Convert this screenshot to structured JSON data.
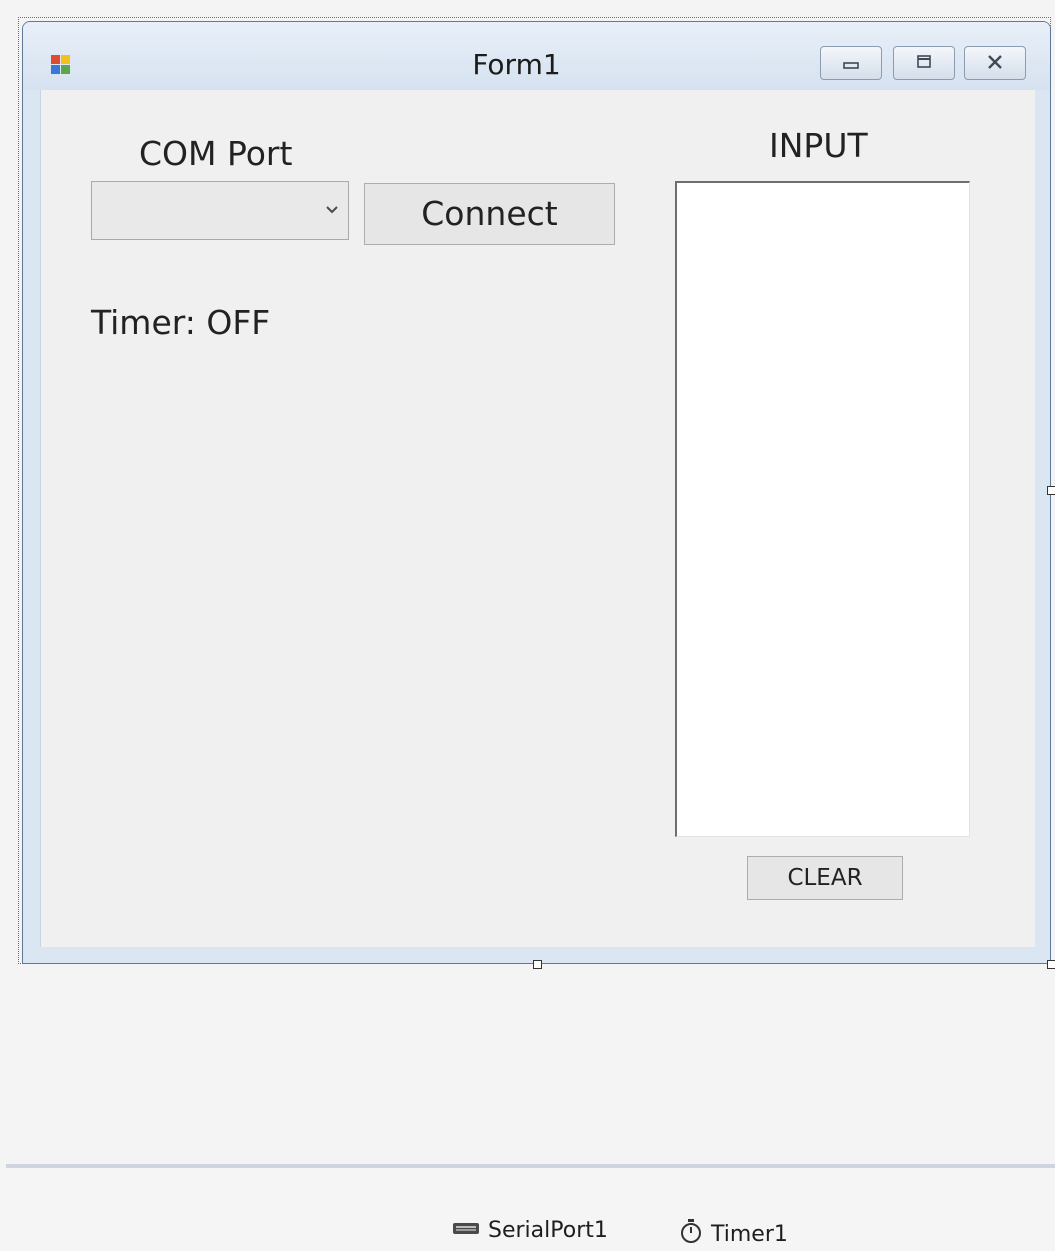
{
  "form": {
    "title": "Form1",
    "com_port_label": "COM Port",
    "com_port_value": "",
    "connect_label": "Connect",
    "timer_status": "Timer: OFF",
    "input_label": "INPUT",
    "input_value": "",
    "clear_label": "CLEAR"
  },
  "tray": {
    "items": [
      {
        "label": "SerialPort1",
        "icon": "serial-port-icon"
      },
      {
        "label": "Timer1",
        "icon": "stopwatch-icon"
      }
    ]
  },
  "colors": {
    "title_bar": "#dbe6f3",
    "client_area": "#f0f0f0",
    "button_face": "#e6e6e6"
  }
}
